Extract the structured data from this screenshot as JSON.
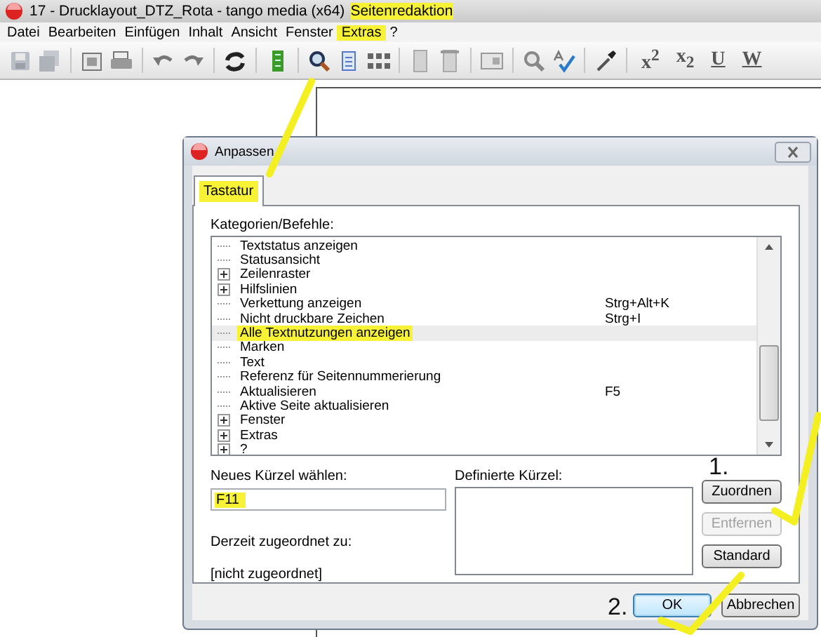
{
  "window": {
    "title": "17 - Drucklayout_DTZ_Rota - tango media (x64)",
    "mode": {
      "label": "Seitenredaktion",
      "highlighted": true
    }
  },
  "menu": [
    {
      "label": "Datei",
      "highlighted": false
    },
    {
      "label": "Bearbeiten",
      "highlighted": false
    },
    {
      "label": "Einfügen",
      "highlighted": false
    },
    {
      "label": "Inhalt",
      "highlighted": false
    },
    {
      "label": "Ansicht",
      "highlighted": false
    },
    {
      "label": "Fenster",
      "highlighted": false
    },
    {
      "label": "Extras",
      "highlighted": true
    },
    {
      "label": "?",
      "highlighted": false
    }
  ],
  "toolbar": {
    "format_buttons": [
      {
        "label": "x$^{2}$",
        "kind": "script"
      },
      {
        "label": "x$_{2}$",
        "kind": "script"
      },
      {
        "label": "U",
        "kind": "underline"
      },
      {
        "label": "W",
        "kind": "underline"
      }
    ]
  },
  "dialog": {
    "title": "Anpassen",
    "tabs": [
      {
        "label": "Tastatur",
        "selected": true,
        "highlighted": true
      }
    ],
    "tree_label": "Kategorien/Befehle:",
    "tree": [
      {
        "children": [
          {
            "label": "Textstatus anzeigen",
            "expandable": false,
            "selected": false,
            "highlighted": false
          },
          {
            "label": "Statusansicht",
            "expandable": false,
            "selected": false,
            "highlighted": false
          },
          {
            "label": "Zeilenraster",
            "expandable": true,
            "selected": false,
            "highlighted": false
          },
          {
            "label": "Hilfslinien",
            "expandable": true,
            "selected": false,
            "highlighted": false
          },
          {
            "label": "Verkettung anzeigen",
            "shortcut": "Strg+Alt+K",
            "expandable": false,
            "selected": false,
            "highlighted": false
          },
          {
            "label": "Nicht druckbare Zeichen",
            "shortcut": "Strg+I",
            "expandable": false,
            "selected": false,
            "highlighted": false
          },
          {
            "label": "Alle Textnutzungen anzeigen",
            "expandable": false,
            "selected": true,
            "highlighted": true
          },
          {
            "label": "Marken",
            "expandable": false,
            "selected": false,
            "highlighted": false
          },
          {
            "label": "Text",
            "expandable": false,
            "selected": false,
            "highlighted": false
          },
          {
            "label": "Referenz für Seitennummerierung",
            "expandable": false,
            "selected": false,
            "highlighted": false
          },
          {
            "label": "Aktualisieren",
            "shortcut": "F5",
            "expandable": false,
            "selected": false,
            "highlighted": false
          },
          {
            "label": "Aktive Seite aktualisieren",
            "expandable": false,
            "selected": false,
            "highlighted": false
          }
        ]
      },
      {
        "label": "Fenster",
        "expandable": true,
        "selected": false,
        "highlighted": false
      },
      {
        "label": "Extras",
        "expandable": true,
        "selected": false,
        "highlighted": false
      },
      {
        "label": "?",
        "expandable": true,
        "selected": false,
        "highlighted": false
      }
    ],
    "new_shortcut": {
      "label": "Neues Kürzel wählen:",
      "value": "F11",
      "highlighted": true
    },
    "defined_label": "Definierte Kürzel:",
    "assigned_label": "Derzeit zugeordnet zu:",
    "assigned_value": "[nicht zugeordnet]",
    "side_buttons": [
      {
        "label": "Zuordnen",
        "disabled": false
      },
      {
        "label": "Entfernen",
        "disabled": true
      },
      {
        "label": "Standard",
        "disabled": false
      }
    ],
    "buttons": [
      {
        "label": "OK",
        "default": true
      },
      {
        "label": "Abbrechen",
        "default": false
      }
    ]
  },
  "annotations": [
    {
      "text": "1."
    },
    {
      "text": "2."
    }
  ]
}
